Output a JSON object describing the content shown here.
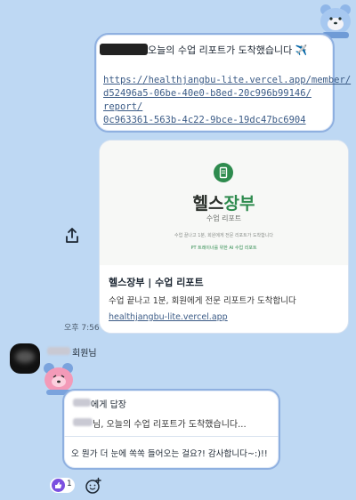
{
  "outgoing_message": {
    "text_tail": "오늘의 수업 리포트가 도착했습니다 ✈️",
    "link_lines": [
      "https://healthjangbu-lite.vercel.app/member/",
      "d52496a5-06be-40e0-b8ed-20c996b99146/",
      "report/",
      "0c963361-563b-4c22-9bce-19dc47bc6904"
    ]
  },
  "link_preview": {
    "brand_part1": "헬스",
    "brand_part2": "장부",
    "subtitle": "수업 리포트",
    "small_line1": "수업 끝나고 1분, 회원에게 전문 리포트가 도착합니다",
    "small_line2": "PT 트레이너를 위한 AI 수업 리포트",
    "title": "헬스장부 | 수업 리포트",
    "description": "수업 끝나고 1분, 회원에게 전문 리포트가 도착합니다",
    "domain": "healthjangbu-lite.vercel.app",
    "accent_color": "#2e8b4e"
  },
  "timestamp": "오후 7:56",
  "sender": {
    "name_suffix": "회원님"
  },
  "reply": {
    "to_suffix": "에게 답장",
    "quote_suffix": "님, 오늘의 수업 리포트가 도착했습니다...",
    "message": "오 뭔가 더 눈에 쏙쏙 들어오는 걸요?! 감사합니다~:)!!"
  },
  "reaction": {
    "count": "1"
  },
  "icons": {
    "share": "share-icon",
    "add_reaction": "add-reaction-icon",
    "thumbs_up": "thumbs-up-icon"
  }
}
